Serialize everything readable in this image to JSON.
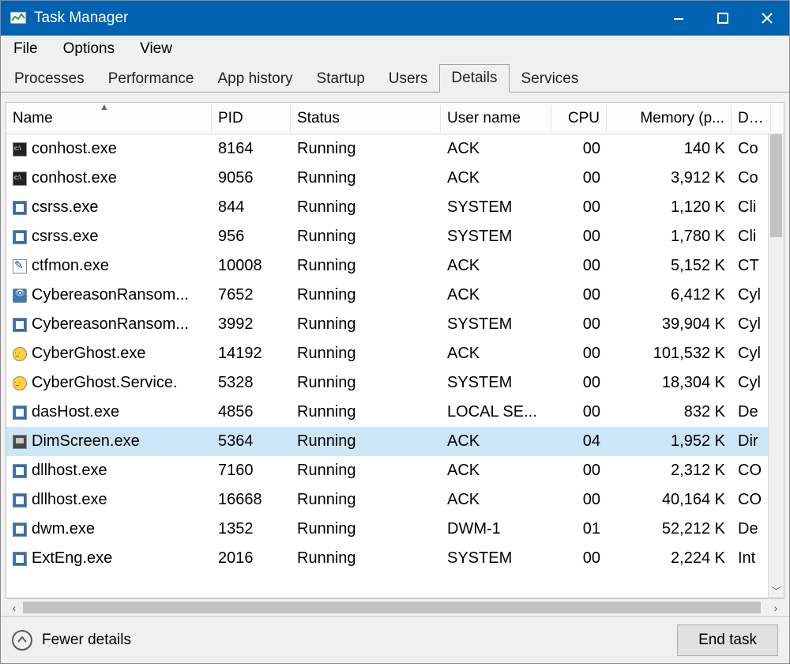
{
  "title": "Task Manager",
  "menu": {
    "file": "File",
    "options": "Options",
    "view": "View"
  },
  "tabs": {
    "processes": "Processes",
    "performance": "Performance",
    "apphistory": "App history",
    "startup": "Startup",
    "users": "Users",
    "details": "Details",
    "services": "Services",
    "active": "details"
  },
  "columns": {
    "name": "Name",
    "pid": "PID",
    "status": "Status",
    "user": "User name",
    "cpu": "CPU",
    "memory": "Memory (p...",
    "description": "Des"
  },
  "sort": {
    "column": "name",
    "direction": "asc"
  },
  "selected_index": 10,
  "rows": [
    {
      "icon": "console",
      "name": "conhost.exe",
      "pid": "8164",
      "status": "Running",
      "user": "ACK",
      "cpu": "00",
      "mem": "140 K",
      "des": "Co"
    },
    {
      "icon": "console",
      "name": "conhost.exe",
      "pid": "9056",
      "status": "Running",
      "user": "ACK",
      "cpu": "00",
      "mem": "3,912 K",
      "des": "Co"
    },
    {
      "icon": "app",
      "name": "csrss.exe",
      "pid": "844",
      "status": "Running",
      "user": "SYSTEM",
      "cpu": "00",
      "mem": "1,120 K",
      "des": "Cli"
    },
    {
      "icon": "app",
      "name": "csrss.exe",
      "pid": "956",
      "status": "Running",
      "user": "SYSTEM",
      "cpu": "00",
      "mem": "1,780 K",
      "des": "Cli"
    },
    {
      "icon": "pencil",
      "name": "ctfmon.exe",
      "pid": "10008",
      "status": "Running",
      "user": "ACK",
      "cpu": "00",
      "mem": "5,152 K",
      "des": "CT"
    },
    {
      "icon": "eye",
      "name": "CybereasonRansom...",
      "pid": "7652",
      "status": "Running",
      "user": "ACK",
      "cpu": "00",
      "mem": "6,412 K",
      "des": "Cyl"
    },
    {
      "icon": "app",
      "name": "CybereasonRansom...",
      "pid": "3992",
      "status": "Running",
      "user": "SYSTEM",
      "cpu": "00",
      "mem": "39,904 K",
      "des": "Cyl"
    },
    {
      "icon": "ghost",
      "name": "CyberGhost.exe",
      "pid": "14192",
      "status": "Running",
      "user": "ACK",
      "cpu": "00",
      "mem": "101,532 K",
      "des": "Cyl"
    },
    {
      "icon": "ghost",
      "name": "CyberGhost.Service.",
      "pid": "5328",
      "status": "Running",
      "user": "SYSTEM",
      "cpu": "00",
      "mem": "18,304 K",
      "des": "Cyl"
    },
    {
      "icon": "app",
      "name": "dasHost.exe",
      "pid": "4856",
      "status": "Running",
      "user": "LOCAL SE...",
      "cpu": "00",
      "mem": "832 K",
      "des": "De"
    },
    {
      "icon": "monitor",
      "name": "DimScreen.exe",
      "pid": "5364",
      "status": "Running",
      "user": "ACK",
      "cpu": "04",
      "mem": "1,952 K",
      "des": "Dir"
    },
    {
      "icon": "app",
      "name": "dllhost.exe",
      "pid": "7160",
      "status": "Running",
      "user": "ACK",
      "cpu": "00",
      "mem": "2,312 K",
      "des": "CO"
    },
    {
      "icon": "app",
      "name": "dllhost.exe",
      "pid": "16668",
      "status": "Running",
      "user": "ACK",
      "cpu": "00",
      "mem": "40,164 K",
      "des": "CO"
    },
    {
      "icon": "app",
      "name": "dwm.exe",
      "pid": "1352",
      "status": "Running",
      "user": "DWM-1",
      "cpu": "01",
      "mem": "52,212 K",
      "des": "De"
    },
    {
      "icon": "app",
      "name": "ExtEng.exe",
      "pid": "2016",
      "status": "Running",
      "user": "SYSTEM",
      "cpu": "00",
      "mem": "2,224 K",
      "des": "Int"
    }
  ],
  "footer": {
    "fewer": "Fewer details",
    "end": "End task"
  }
}
